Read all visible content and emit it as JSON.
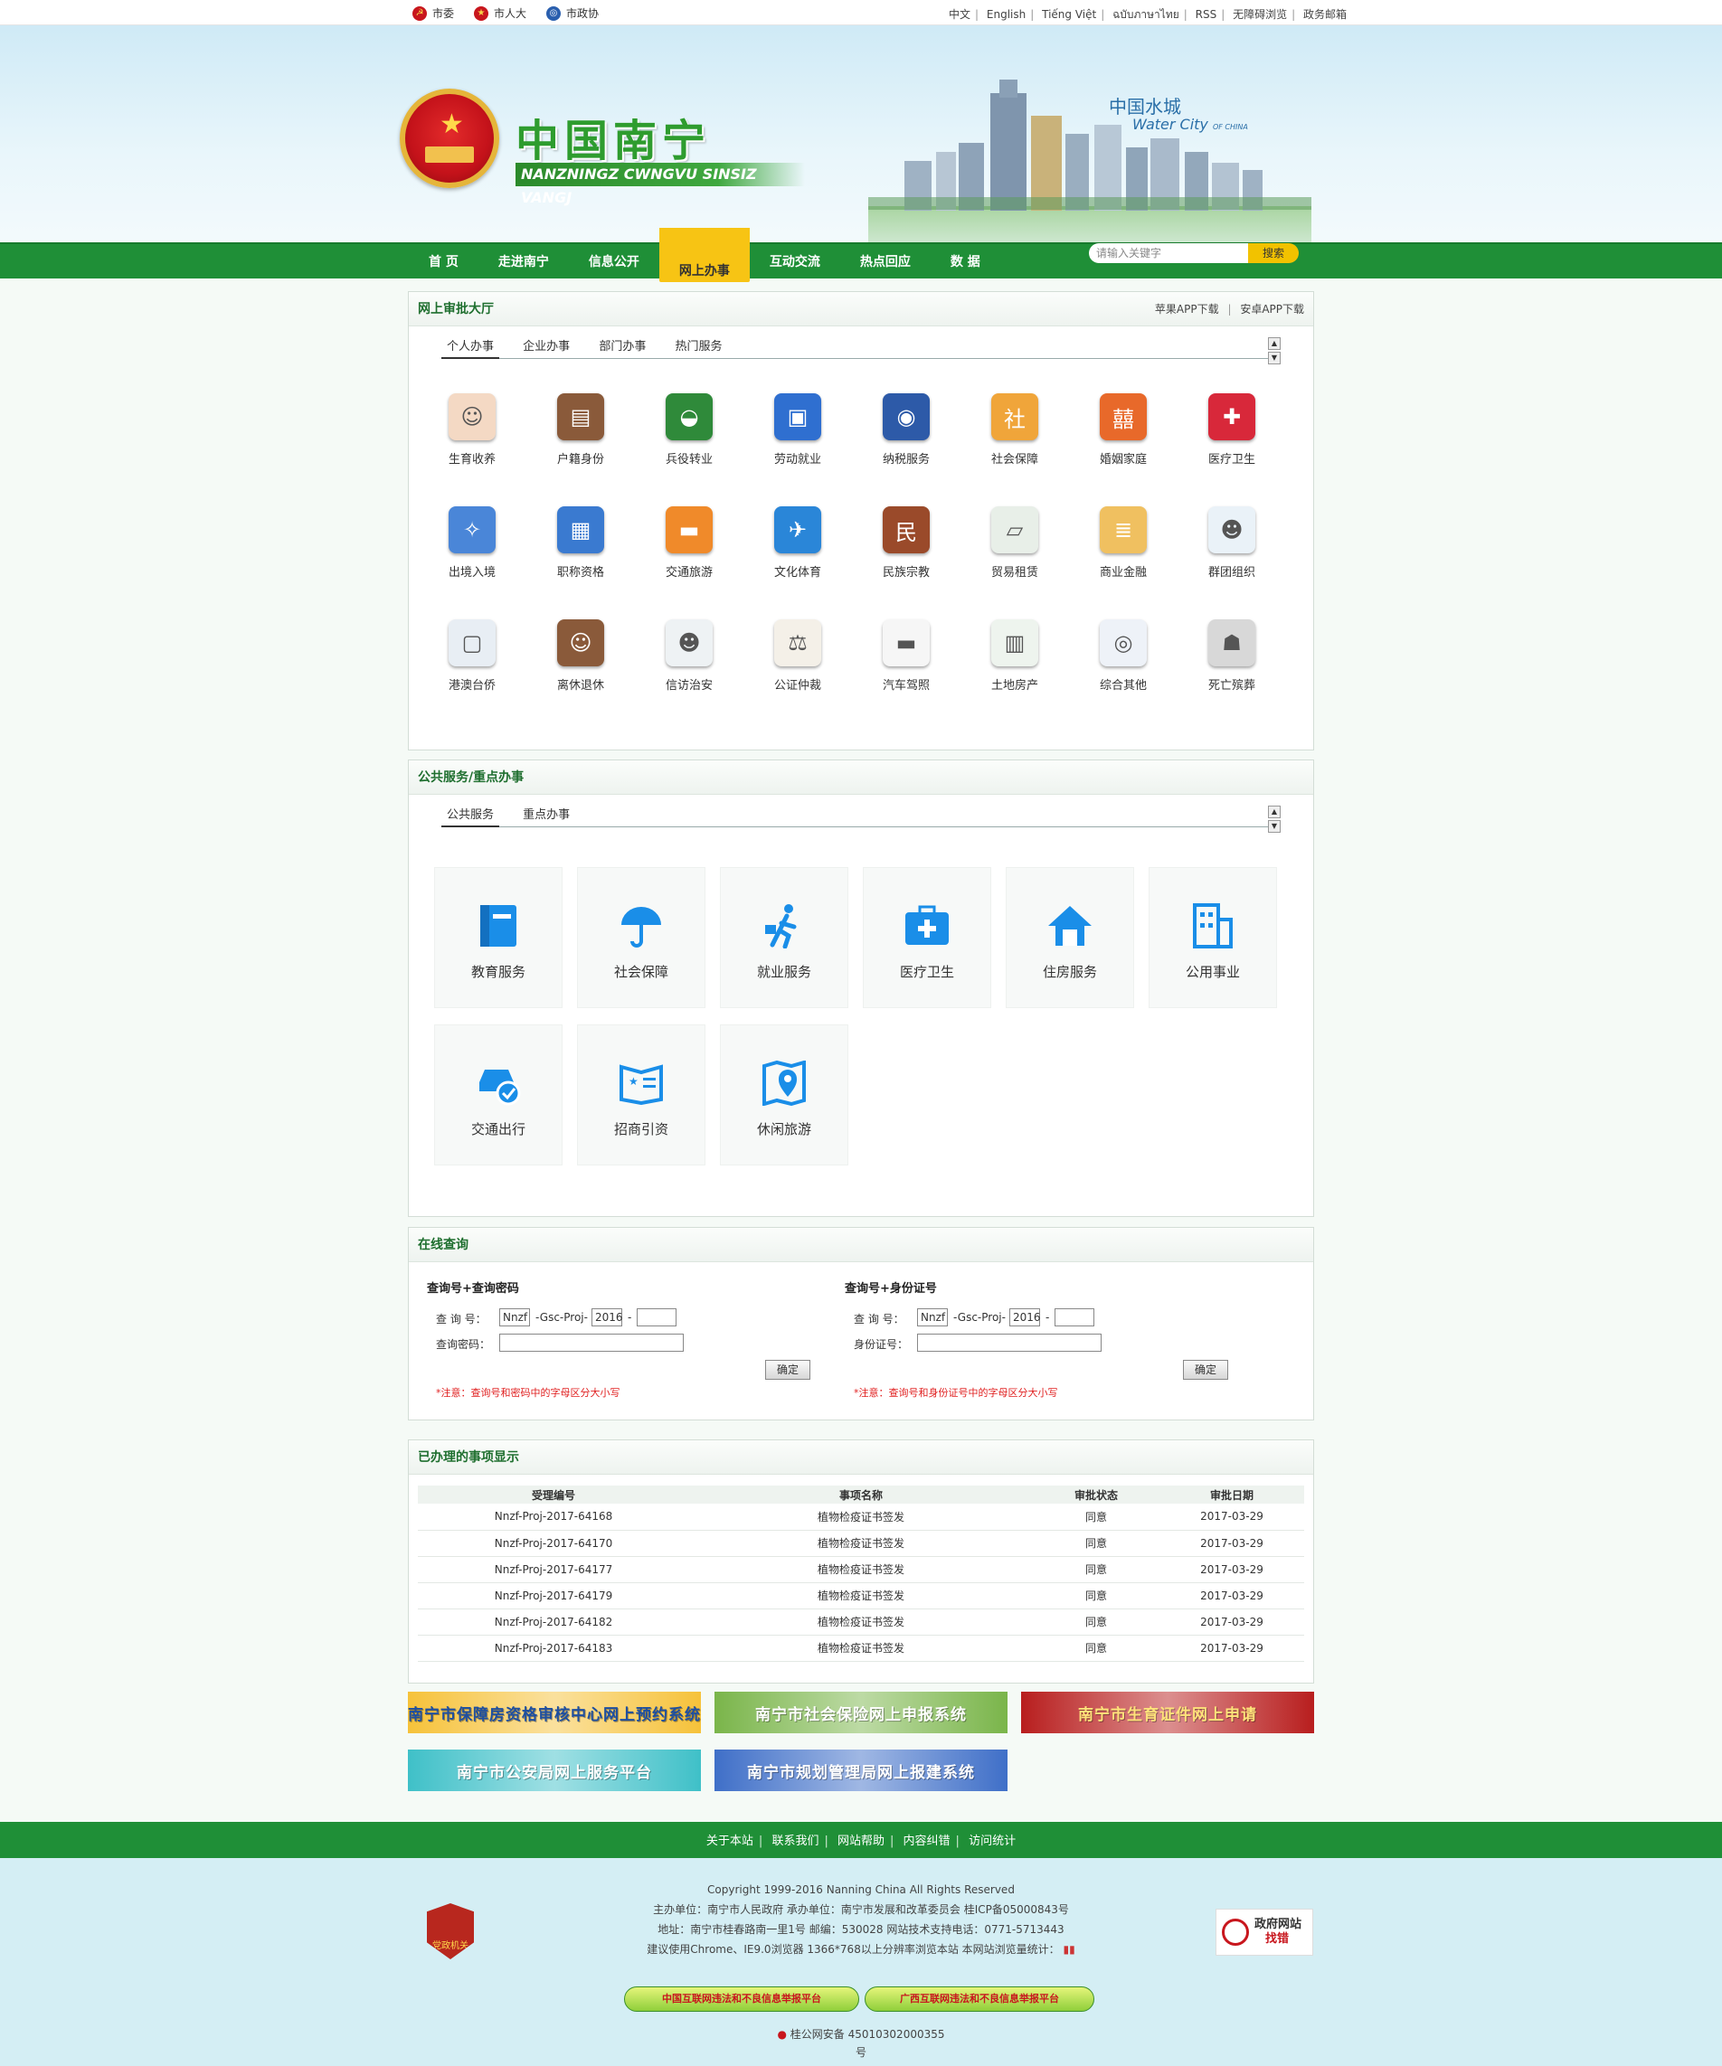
{
  "topbar": {
    "left_links": [
      "市委",
      "市人大",
      "市政协"
    ],
    "right_links": [
      "中文",
      "English",
      "Tiếng Việt",
      "ฉบับภาษาไทย",
      "RSS",
      "无障碍浏览",
      "政务邮箱"
    ]
  },
  "banner": {
    "site_title": "中国南宁",
    "site_subtitle": "NANZNINGZ CWNGVU SINSIZ VANGJ",
    "city_slogan_cn": "中国水城",
    "city_slogan_en": "Water City",
    "city_slogan_small": "OF CHINA"
  },
  "nav": {
    "items": [
      "首 页",
      "走进南宁",
      "信息公开",
      "网上办事",
      "互动交流",
      "热点回应",
      "数 据"
    ],
    "active": "网上办事",
    "search_placeholder": "请输入关键字",
    "search_button": "搜索"
  },
  "approval_hall": {
    "title": "网上审批大厅",
    "app_links": [
      "苹果APP下载",
      "安卓APP下载"
    ],
    "tabs": [
      "个人办事",
      "企业办事",
      "部门办事",
      "热门服务"
    ],
    "active_tab": "个人办事",
    "services": [
      {
        "label": "生育收养",
        "icon": "baby-icon",
        "color": "#f4d9c4"
      },
      {
        "label": "户籍身份",
        "icon": "household-book-icon",
        "color": "#8a5a3a"
      },
      {
        "label": "兵役转业",
        "icon": "military-beret-icon",
        "color": "#2f8a3a"
      },
      {
        "label": "劳动就业",
        "icon": "briefcase-icon",
        "color": "#2f6fd0"
      },
      {
        "label": "纳税服务",
        "icon": "tax-emblem-icon",
        "color": "#2d5aa8"
      },
      {
        "label": "社会保障",
        "icon": "social-security-icon",
        "color": "#f0a53a"
      },
      {
        "label": "婚姻家庭",
        "icon": "double-happiness-icon",
        "color": "#e8692a"
      },
      {
        "label": "医疗卫生",
        "icon": "medical-kit-icon",
        "color": "#d8283a"
      },
      {
        "label": "出境入境",
        "icon": "globe-network-icon",
        "color": "#4a86d8"
      },
      {
        "label": "职称资格",
        "icon": "certificate-icon",
        "color": "#3a7ad0"
      },
      {
        "label": "交通旅游",
        "icon": "car-icon",
        "color": "#f08a2a"
      },
      {
        "label": "文化体育",
        "icon": "runner-icon",
        "color": "#2a86d8"
      },
      {
        "label": "民族宗教",
        "icon": "ethnic-religion-icon",
        "color": "#9a4a2a"
      },
      {
        "label": "贸易租赁",
        "icon": "trade-document-icon",
        "color": "#e8efe8"
      },
      {
        "label": "商业金融",
        "icon": "ledger-icon",
        "color": "#f0c060"
      },
      {
        "label": "群团组织",
        "icon": "group-people-icon",
        "color": "#eaf2f8"
      },
      {
        "label": "港澳台侨",
        "icon": "id-card-person-icon",
        "color": "#e8eef4"
      },
      {
        "label": "离休退休",
        "icon": "retiree-icon",
        "color": "#8a5a3a"
      },
      {
        "label": "信访治安",
        "icon": "officer-icon",
        "color": "#eef2f4"
      },
      {
        "label": "公证仲裁",
        "icon": "scales-icon",
        "color": "#f4f0e8"
      },
      {
        "label": "汽车驾照",
        "icon": "red-car-icon",
        "color": "#f6f6f6"
      },
      {
        "label": "土地房产",
        "icon": "building-icon",
        "color": "#eef4ee"
      },
      {
        "label": "综合其他",
        "icon": "orbit-icon",
        "color": "#eef2f8"
      },
      {
        "label": "死亡殡葬",
        "icon": "mourners-icon",
        "color": "#d8d8d8"
      }
    ]
  },
  "public_services": {
    "title": "公共服务/重点办事",
    "tabs": [
      "公共服务",
      "重点办事"
    ],
    "active_tab": "公共服务",
    "tiles": [
      {
        "label": "教育服务",
        "icon": "book-icon"
      },
      {
        "label": "社会保障",
        "icon": "umbrella-icon"
      },
      {
        "label": "就业服务",
        "icon": "walking-briefcase-icon"
      },
      {
        "label": "医疗卫生",
        "icon": "first-aid-icon"
      },
      {
        "label": "住房服务",
        "icon": "house-icon"
      },
      {
        "label": "公用事业",
        "icon": "office-building-icon"
      },
      {
        "label": "交通出行",
        "icon": "car-check-icon"
      },
      {
        "label": "招商引资",
        "icon": "open-book-star-icon"
      },
      {
        "label": "休闲旅游",
        "icon": "map-pin-icon"
      }
    ],
    "icon_color": "#1a8ee8"
  },
  "online_query": {
    "title": "在线查询",
    "left": {
      "heading": "查询号+查询密码",
      "label_number": "查 询 号：",
      "label_second": "查询密码：",
      "prefix": "Nnzf",
      "middle": "-Gsc-Proj-",
      "year": "2016",
      "dash": "-",
      "button": "确定",
      "note": "*注意：查询号和密码中的字母区分大小写"
    },
    "right": {
      "heading": "查询号+身份证号",
      "label_number": "查 询 号：",
      "label_second": "身份证号：",
      "prefix": "Nnzf",
      "middle": "-Gsc-Proj-",
      "year": "2016",
      "dash": "-",
      "button": "确定",
      "note": "*注意：查询号和身份证号中的字母区分大小写"
    }
  },
  "processed": {
    "title": "已办理的事项显示",
    "columns": [
      "受理编号",
      "事项名称",
      "审批状态",
      "审批日期"
    ],
    "rows": [
      [
        "Nnzf-Proj-2017-64168",
        "植物检疫证书签发",
        "同意",
        "2017-03-29"
      ],
      [
        "Nnzf-Proj-2017-64170",
        "植物检疫证书签发",
        "同意",
        "2017-03-29"
      ],
      [
        "Nnzf-Proj-2017-64177",
        "植物检疫证书签发",
        "同意",
        "2017-03-29"
      ],
      [
        "Nnzf-Proj-2017-64179",
        "植物检疫证书签发",
        "同意",
        "2017-03-29"
      ],
      [
        "Nnzf-Proj-2017-64182",
        "植物检疫证书签发",
        "同意",
        "2017-03-29"
      ],
      [
        "Nnzf-Proj-2017-64183",
        "植物检疫证书签发",
        "同意",
        "2017-03-29"
      ]
    ]
  },
  "promo_banners": [
    {
      "label": "南宁市保障房资格审核中心网上预约系统",
      "bg": "#f6c23a",
      "fg": "#1e4fa0"
    },
    {
      "label": "南宁市社会保险网上申报系统",
      "bg": "#7ab54a",
      "fg": "#ffffff"
    },
    {
      "label": "南宁市生育证件网上申请",
      "bg": "#b81e1e",
      "fg": "#ffe27a"
    },
    {
      "label": "南宁市公安局网上服务平台",
      "bg": "#3fc0c8",
      "fg": "#ffffff"
    },
    {
      "label": "南宁市规划管理局网上报建系统",
      "bg": "#3f6fc8",
      "fg": "#ffffff"
    }
  ],
  "footer": {
    "links": [
      "关于本站",
      "联系我们",
      "网站帮助",
      "内容纠错",
      "访问统计"
    ],
    "copyright": "Copyright 1999-2016 Nanning China All Rights Reserved",
    "sponsor": "主办单位：南宁市人民政府  承办单位：南宁市发展和改革委员会  桂ICP备05000843号",
    "address": "地址：南宁市桂春路南一里1号 邮编：530028 网站技术支持电话：0771-5713443",
    "browser": "建议使用Chrome、IE9.0浏览器 1366*768以上分辨率浏览本站  本网站浏览量统计：",
    "badge_left": "党政机关",
    "badge_right_top": "政府网站",
    "badge_right_bottom": "找错",
    "report_buttons": [
      "中国互联网违法和不良信息举报平台",
      "广西互联网违法和不良信息举报平台"
    ],
    "police": "桂公网安备 45010302000355",
    "police_suffix": "号"
  }
}
